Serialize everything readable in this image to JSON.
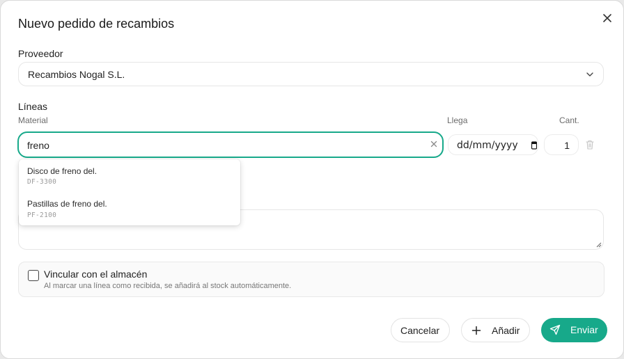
{
  "dialog": {
    "title": "Nuevo pedido de recambios"
  },
  "supplier": {
    "label": "Proveedor",
    "value": "Recambios Nogal S.L."
  },
  "lines": {
    "label": "Líneas",
    "col_material": "Material",
    "col_arrival": "Llega",
    "col_qty": "Cant.",
    "material_value": "freno",
    "date_placeholder": "dd/mm/yyyy",
    "qty_value": "1"
  },
  "suggestions": [
    {
      "name": "Disco de freno del.",
      "code": "DF-3300"
    },
    {
      "name": "Pastillas de freno del.",
      "code": "PF-2100"
    }
  ],
  "warehouse": {
    "title": "Vincular con el almacén",
    "help": "Al marcar una línea como recibida, se añadirá al stock automáticamente."
  },
  "actions": {
    "cancel": "Cancelar",
    "add": "Añadir",
    "send": "Enviar"
  },
  "colors": {
    "accent": "#17a98a"
  },
  "icons": [
    "close-icon",
    "chevron-down-icon",
    "clear-icon",
    "calendar-icon",
    "trash-icon",
    "plus-icon",
    "send-icon"
  ]
}
